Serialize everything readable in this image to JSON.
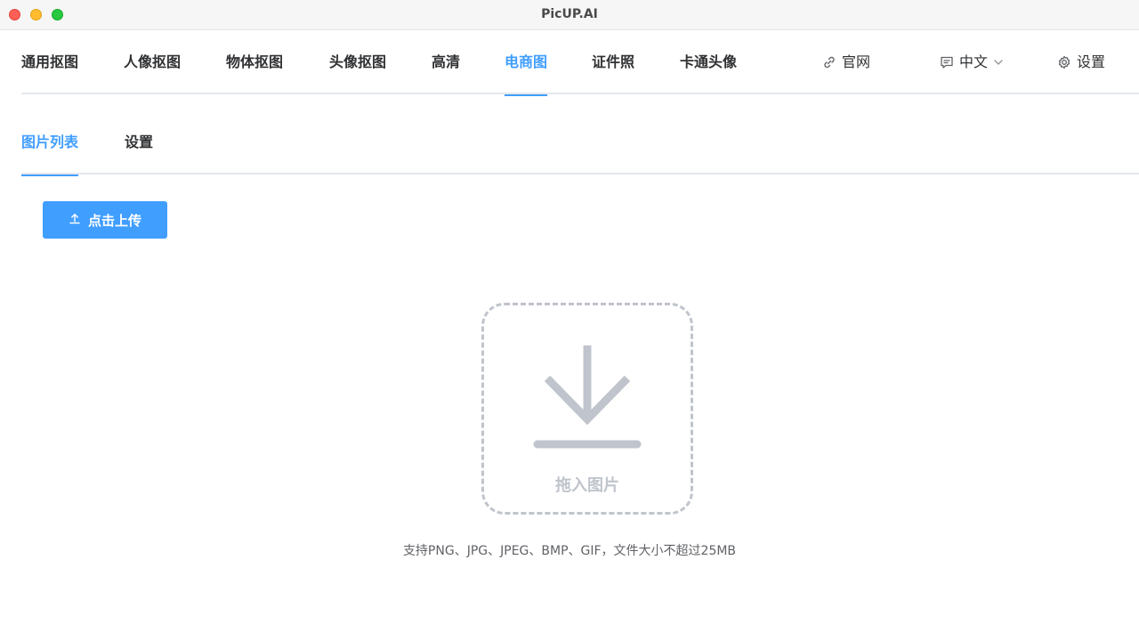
{
  "window": {
    "title": "PicUP.AI"
  },
  "nav": {
    "items": [
      "通用抠图",
      "人像抠图",
      "物体抠图",
      "头像抠图",
      "高清",
      "电商图",
      "证件照",
      "卡通头像"
    ],
    "active_index": 5,
    "website_label": "官网",
    "language_label": "中文",
    "settings_label": "设置"
  },
  "subtabs": {
    "items": [
      "图片列表",
      "设置"
    ],
    "active_index": 0
  },
  "upload": {
    "button_label": "点击上传"
  },
  "dropzone": {
    "label": "拖入图片",
    "hint": "支持PNG、JPG、JPEG、BMP、GIF，文件大小不超过25MB"
  },
  "colors": {
    "accent": "#409eff",
    "text": "#303133",
    "muted": "#c0c4cc",
    "divider": "#e4e7ed"
  },
  "icons": {
    "website": "link-icon",
    "language": "message-icon",
    "language_dropdown": "chevron-down-icon",
    "settings": "gear-icon",
    "upload": "upload-icon",
    "dropzone": "download-icon"
  }
}
